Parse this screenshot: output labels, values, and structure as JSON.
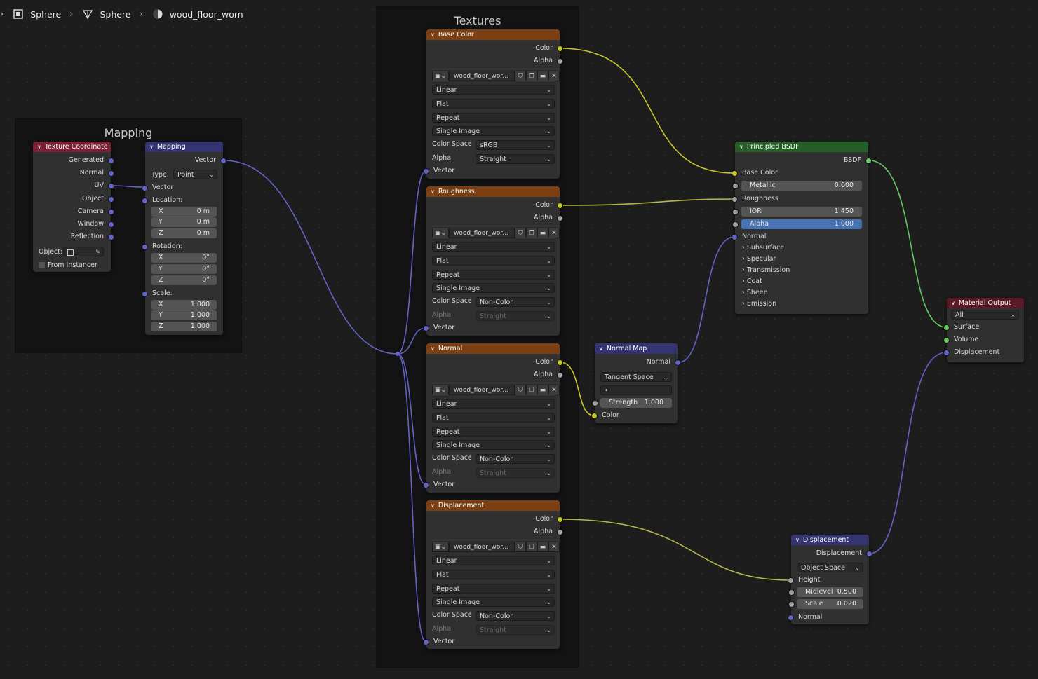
{
  "breadcrumb": {
    "items": [
      "Sphere",
      "Sphere",
      "wood_floor_worn"
    ]
  },
  "colors": {
    "tex_header": "#7a3f13",
    "vector_header": "#343470",
    "input_header": "#7a2138",
    "shader_header": "#275e28",
    "output_header": "#5a1a25",
    "wire_color": "#c7c729",
    "wire_vector": "#6363c7",
    "wire_shader": "#63c763",
    "wire_float": "#a1a1a1",
    "active_field": "#4772b3"
  },
  "frames": {
    "mapping": "Mapping",
    "textures": "Textures"
  },
  "texcoord": {
    "title": "Texture Coordinate",
    "outputs": [
      "Generated",
      "Normal",
      "UV",
      "Object",
      "Camera",
      "Window",
      "Reflection"
    ],
    "object_label": "Object:",
    "from_instancer": "From Instancer"
  },
  "mapping": {
    "title": "Mapping",
    "out": "Vector",
    "type_label": "Type:",
    "type_value": "Point",
    "vector_in": "Vector",
    "location_label": "Location:",
    "location": [
      {
        "axis": "X",
        "val": "0 m"
      },
      {
        "axis": "Y",
        "val": "0 m"
      },
      {
        "axis": "Z",
        "val": "0 m"
      }
    ],
    "rotation_label": "Rotation:",
    "rotation": [
      {
        "axis": "X",
        "val": "0°"
      },
      {
        "axis": "Y",
        "val": "0°"
      },
      {
        "axis": "Z",
        "val": "0°"
      }
    ],
    "scale_label": "Scale:",
    "scale": [
      {
        "axis": "X",
        "val": "1.000"
      },
      {
        "axis": "Y",
        "val": "1.000"
      },
      {
        "axis": "Z",
        "val": "1.000"
      }
    ]
  },
  "textures": [
    {
      "title": "Base Color",
      "image": "wood_floor_wor...",
      "interp": "Linear",
      "proj": "Flat",
      "ext": "Repeat",
      "source": "Single Image",
      "colorspace_label": "Color Space",
      "colorspace": "sRGB",
      "alpha_label": "Alpha",
      "alpha": "Straight",
      "alpha_enabled": true,
      "out_color": "Color",
      "out_alpha": "Alpha",
      "in_vector": "Vector"
    },
    {
      "title": "Roughness",
      "image": "wood_floor_wor...",
      "interp": "Linear",
      "proj": "Flat",
      "ext": "Repeat",
      "source": "Single Image",
      "colorspace_label": "Color Space",
      "colorspace": "Non-Color",
      "alpha_label": "Alpha",
      "alpha": "Straight",
      "alpha_enabled": false,
      "out_color": "Color",
      "out_alpha": "Alpha",
      "in_vector": "Vector"
    },
    {
      "title": "Normal",
      "image": "wood_floor_wor...",
      "interp": "Linear",
      "proj": "Flat",
      "ext": "Repeat",
      "source": "Single Image",
      "colorspace_label": "Color Space",
      "colorspace": "Non-Color",
      "alpha_label": "Alpha",
      "alpha": "Straight",
      "alpha_enabled": false,
      "out_color": "Color",
      "out_alpha": "Alpha",
      "in_vector": "Vector"
    },
    {
      "title": "Displacement",
      "image": "wood_floor_wor...",
      "interp": "Linear",
      "proj": "Flat",
      "ext": "Repeat",
      "source": "Single Image",
      "colorspace_label": "Color Space",
      "colorspace": "Non-Color",
      "alpha_label": "Alpha",
      "alpha": "Straight",
      "alpha_enabled": false,
      "out_color": "Color",
      "out_alpha": "Alpha",
      "in_vector": "Vector"
    }
  ],
  "normalmap": {
    "title": "Normal Map",
    "out": "Normal",
    "space": "Tangent Space",
    "uvmap": "•",
    "strength_label": "Strength",
    "strength": "1.000",
    "in_color": "Color"
  },
  "bsdf": {
    "title": "Principled BSDF",
    "out": "BSDF",
    "base_color": "Base Color",
    "metallic_label": "Metallic",
    "metallic": "0.000",
    "roughness": "Roughness",
    "ior_label": "IOR",
    "ior": "1.450",
    "alpha_label": "Alpha",
    "alpha": "1.000",
    "normal": "Normal",
    "panels": [
      "Subsurface",
      "Specular",
      "Transmission",
      "Coat",
      "Sheen",
      "Emission"
    ]
  },
  "output": {
    "title": "Material Output",
    "target": "All",
    "inputs": [
      "Surface",
      "Volume",
      "Displacement"
    ]
  },
  "displacement": {
    "title": "Displacement",
    "out": "Displacement",
    "space": "Object Space",
    "height": "Height",
    "midlevel_label": "Midlevel",
    "midlevel": "0.500",
    "scale_label": "Scale",
    "scale": "0.020",
    "normal": "Normal"
  }
}
